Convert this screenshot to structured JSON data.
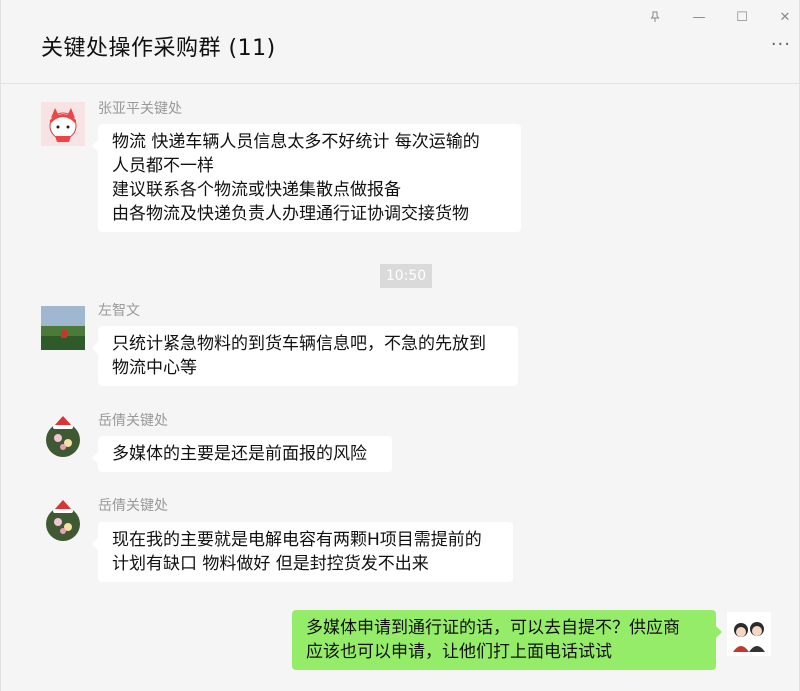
{
  "window": {
    "title": "关键处操作采购群 (11)",
    "controls": {
      "pin_icon": "pin-icon",
      "minimize_glyph": "—",
      "maximize_glyph": "☐",
      "close_glyph": "✕"
    },
    "more_glyph": "···"
  },
  "chat": {
    "timestamp": "10:50",
    "messages": [
      {
        "sender": "张亚平关键处",
        "lines": [
          "物流  快递车辆人员信息太多不好统计  每次运输的",
          "人员都不一样",
          "建议联系各个物流或快递集散点做报备",
          "由各物流及快递负责人办理通行证协调交接货物"
        ]
      },
      {
        "sender": "左智文",
        "lines": [
          "只统计紧急物料的到货车辆信息吧，不急的先放到",
          "物流中心等"
        ]
      },
      {
        "sender": "岳倩关键处",
        "lines": [
          "多媒体的主要是还是前面报的风险"
        ]
      },
      {
        "sender": "岳倩关键处",
        "lines": [
          "现在我的主要就是电解电容有两颗H项目需提前的",
          "计划有缺口 物料做好 但是封控货发不出来"
        ]
      },
      {
        "sender": "",
        "lines": [
          "多媒体申请到通行证的话，可以去自提不？供应商",
          "应该也可以申请，让他们打上面电话试试"
        ]
      }
    ]
  },
  "colors": {
    "background": "#f5f5f5",
    "bubble_other": "#ffffff",
    "bubble_mine": "#95ec69",
    "sender_text": "#999999"
  }
}
